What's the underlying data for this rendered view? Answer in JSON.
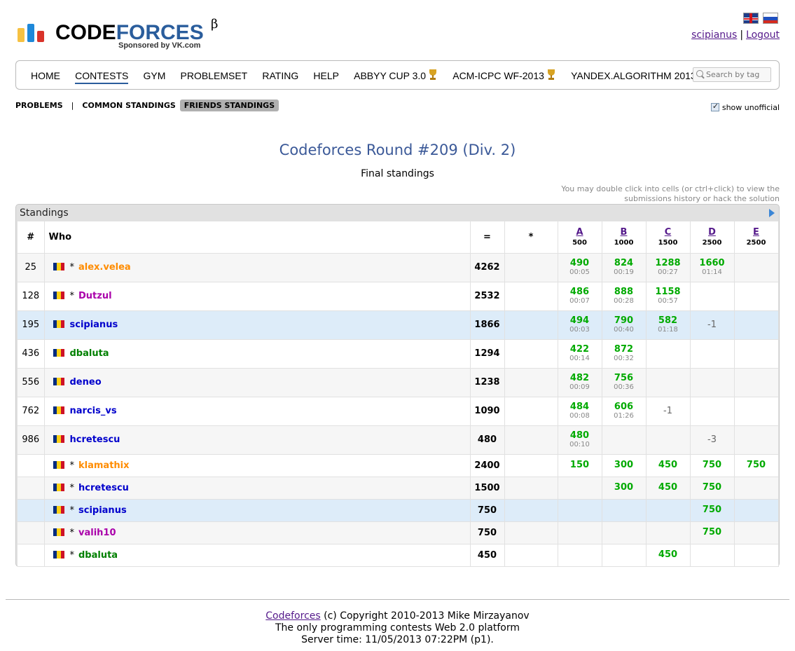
{
  "brand": {
    "name_dark": "CODE",
    "name_blue": "FORCES",
    "beta": "β",
    "sponsor": "Sponsored by VK.com"
  },
  "user": {
    "handle": "scipianus",
    "separator": "|",
    "logout": "Logout"
  },
  "menu": {
    "items": [
      "HOME",
      "CONTESTS",
      "GYM",
      "PROBLEMSET",
      "RATING",
      "HELP",
      "ABBYY CUP 3.0",
      "ACM-ICPC WF-2013",
      "YANDEX.ALGORITHM 2013"
    ],
    "search_placeholder": "Search by tag"
  },
  "submenu": {
    "problems": "PROBLEMS",
    "sep": "|",
    "common": "COMMON STANDINGS",
    "friends": "FRIENDS STANDINGS",
    "show_unofficial": "show unofficial"
  },
  "contest": {
    "title": "Codeforces Round #209 (Div. 2)",
    "subtitle": "Final standings",
    "hint": "You may double click into cells (or ctrl+click) to view the submissions history or hack the solution"
  },
  "standings": {
    "title": "Standings",
    "headers": {
      "rank": "#",
      "who": "Who",
      "points": "=",
      "penalty": "*"
    },
    "problems": [
      {
        "letter": "A",
        "score": "500"
      },
      {
        "letter": "B",
        "score": "1000"
      },
      {
        "letter": "C",
        "score": "1500"
      },
      {
        "letter": "D",
        "score": "2500"
      },
      {
        "letter": "E",
        "score": "2500"
      }
    ],
    "rows": [
      {
        "rank": "25",
        "star": "*",
        "handle": "alex.velea",
        "color": "orange",
        "points": "4262",
        "cells": [
          [
            "490",
            "00:05"
          ],
          [
            "824",
            "00:19"
          ],
          [
            "1288",
            "00:27"
          ],
          [
            "1660",
            "01:14"
          ],
          null
        ],
        "style": "odd"
      },
      {
        "rank": "128",
        "star": "*",
        "handle": "Dutzul",
        "color": "purple",
        "points": "2532",
        "cells": [
          [
            "486",
            "00:07"
          ],
          [
            "888",
            "00:28"
          ],
          [
            "1158",
            "00:57"
          ],
          null,
          null
        ],
        "style": ""
      },
      {
        "rank": "195",
        "star": "",
        "handle": "scipianus",
        "color": "blue",
        "points": "1866",
        "cells": [
          [
            "494",
            "00:03"
          ],
          [
            "790",
            "00:40"
          ],
          [
            "582",
            "01:18"
          ],
          [
            "-1"
          ],
          null
        ],
        "style": "hl"
      },
      {
        "rank": "436",
        "star": "",
        "handle": "dbaluta",
        "color": "green",
        "points": "1294",
        "cells": [
          [
            "422",
            "00:14"
          ],
          [
            "872",
            "00:32"
          ],
          null,
          null,
          null
        ],
        "style": ""
      },
      {
        "rank": "556",
        "star": "",
        "handle": "deneo",
        "color": "blue",
        "points": "1238",
        "cells": [
          [
            "482",
            "00:09"
          ],
          [
            "756",
            "00:36"
          ],
          null,
          null,
          null
        ],
        "style": "odd"
      },
      {
        "rank": "762",
        "star": "",
        "handle": "narcis_vs",
        "color": "blue",
        "points": "1090",
        "cells": [
          [
            "484",
            "00:08"
          ],
          [
            "606",
            "01:26"
          ],
          [
            "-1"
          ],
          null,
          null
        ],
        "style": ""
      },
      {
        "rank": "986",
        "star": "",
        "handle": "hcretescu",
        "color": "blue",
        "points": "480",
        "cells": [
          [
            "480",
            "00:10"
          ],
          null,
          null,
          [
            "-3"
          ],
          null
        ],
        "style": "odd"
      },
      {
        "rank": "",
        "star": "*",
        "handle": "klamathix",
        "color": "orange",
        "points": "2400",
        "cells": [
          [
            "150"
          ],
          [
            "300"
          ],
          [
            "450"
          ],
          [
            "750"
          ],
          [
            "750"
          ]
        ],
        "style": "short"
      },
      {
        "rank": "",
        "star": "*",
        "handle": "hcretescu",
        "color": "blue",
        "points": "1500",
        "cells": [
          null,
          [
            "300"
          ],
          [
            "450"
          ],
          [
            "750"
          ],
          null
        ],
        "style": "short odd"
      },
      {
        "rank": "",
        "star": "*",
        "handle": "scipianus",
        "color": "blue",
        "points": "750",
        "cells": [
          null,
          null,
          null,
          [
            "750"
          ],
          null
        ],
        "style": "short hl"
      },
      {
        "rank": "",
        "star": "*",
        "handle": "valih10",
        "color": "purple",
        "points": "750",
        "cells": [
          null,
          null,
          null,
          [
            "750"
          ],
          null
        ],
        "style": "short odd"
      },
      {
        "rank": "",
        "star": "*",
        "handle": "dbaluta",
        "color": "green",
        "points": "450",
        "cells": [
          null,
          null,
          [
            "450"
          ],
          null,
          null
        ],
        "style": "short"
      }
    ]
  },
  "footer": {
    "link": "Codeforces",
    "copyright": " (c) Copyright 2010-2013 Mike Mirzayanov",
    "line2": "The only programming contests Web 2.0 platform",
    "line3": "Server time: 11/05/2013 07:22PM (p1)."
  },
  "colors": {
    "orange": "#ff8c00",
    "purple": "#aa00aa",
    "blue": "#0000cc",
    "green": "#008000",
    "accepted": "#00aa00",
    "highlight": "#ddecf9"
  }
}
